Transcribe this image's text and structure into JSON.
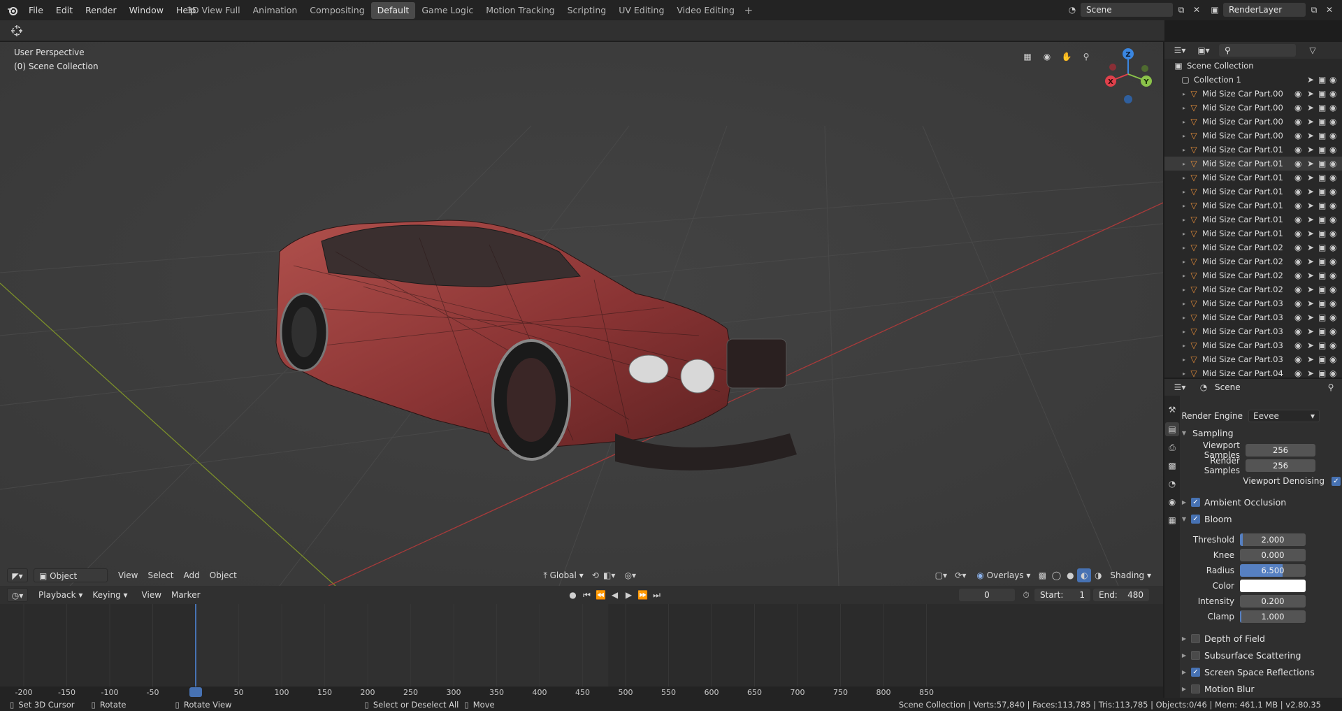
{
  "menu": [
    "File",
    "Edit",
    "Render",
    "Window",
    "Help"
  ],
  "workspaces": [
    {
      "label": "3D View Full",
      "active": false
    },
    {
      "label": "Animation",
      "active": false
    },
    {
      "label": "Compositing",
      "active": false
    },
    {
      "label": "Default",
      "active": true
    },
    {
      "label": "Game Logic",
      "active": false
    },
    {
      "label": "Motion Tracking",
      "active": false
    },
    {
      "label": "Scripting",
      "active": false
    },
    {
      "label": "UV Editing",
      "active": false
    },
    {
      "label": "Video Editing",
      "active": false
    }
  ],
  "scene_field": "Scene",
  "renderlayer_field": "RenderLayer",
  "viewport": {
    "perspective": "User Perspective",
    "collection": "(0) Scene Collection",
    "gizmo": {
      "x": "X",
      "y": "Y",
      "z": "Z"
    },
    "header": {
      "mode": "Object Mode",
      "view": "View",
      "select": "Select",
      "add": "Add",
      "object": "Object",
      "orientation": "Global",
      "overlays": "Overlays",
      "shading": "Shading"
    }
  },
  "timeline": {
    "playback": "Playback",
    "keying": "Keying",
    "view": "View",
    "marker": "Marker",
    "current_frame": "0",
    "start_label": "Start:",
    "start": "1",
    "end_label": "End:",
    "end": "480",
    "ruler": [
      "-200",
      "-150",
      "-100",
      "-50",
      "0",
      "50",
      "100",
      "150",
      "200",
      "250",
      "300",
      "350",
      "400",
      "450",
      "500",
      "550",
      "600",
      "650",
      "700",
      "750",
      "800",
      "850"
    ]
  },
  "status": {
    "left": [
      {
        "label": "Set 3D Cursor",
        "icon": "mouse-left-icon"
      },
      {
        "label": "Rotate",
        "icon": "mouse-middle-icon"
      },
      {
        "label": "Rotate View",
        "icon": "mouse-middle-icon"
      },
      {
        "label": "Select or Deselect All",
        "icon": "mouse-left-icon"
      },
      {
        "label": "Move",
        "icon": "mouse-drag-icon"
      }
    ],
    "right": "Scene Collection | Verts:57,840 | Faces:113,785 | Tris:113,785 | Objects:0/46 | Mem: 461.1 MB | v2.80.35"
  },
  "outliner": {
    "root": "Scene Collection",
    "collection": "Collection 1",
    "items": [
      "Mid Size Car Part.00",
      "Mid Size Car Part.00",
      "Mid Size Car Part.00",
      "Mid Size Car Part.00",
      "Mid Size Car Part.01",
      "Mid Size Car Part.01",
      "Mid Size Car Part.01",
      "Mid Size Car Part.01",
      "Mid Size Car Part.01",
      "Mid Size Car Part.01",
      "Mid Size Car Part.01",
      "Mid Size Car Part.02",
      "Mid Size Car Part.02",
      "Mid Size Car Part.02",
      "Mid Size Car Part.02",
      "Mid Size Car Part.03",
      "Mid Size Car Part.03",
      "Mid Size Car Part.03",
      "Mid Size Car Part.03",
      "Mid Size Car Part.03",
      "Mid Size Car Part.04"
    ],
    "selected_index": 5
  },
  "properties": {
    "context": "Scene",
    "render_engine_label": "Render Engine",
    "render_engine": "Eevee",
    "sampling": "Sampling",
    "viewport_samples_label": "Viewport Samples",
    "viewport_samples": "256",
    "render_samples_label": "Render Samples",
    "render_samples": "256",
    "viewport_denoising": "Viewport Denoising",
    "ambient_occlusion": "Ambient Occlusion",
    "bloom": "Bloom",
    "threshold_label": "Threshold",
    "threshold": "2.000",
    "threshold_fill": 0.04,
    "knee_label": "Knee",
    "knee": "0.000",
    "radius_label": "Radius",
    "radius": "6.500",
    "radius_fill": 0.65,
    "color_label": "Color",
    "color_value": "#ffffff",
    "intensity_label": "Intensity",
    "intensity": "0.200",
    "clamp_label": "Clamp",
    "clamp": "1.000",
    "clamp_fill": 0.02,
    "depth_of_field": "Depth of Field",
    "subsurface": "Subsurface Scattering",
    "ssr": "Screen Space Reflections",
    "motion_blur": "Motion Blur"
  },
  "colors": {
    "accent": "#4772b3",
    "object_icon": "#e88f3a",
    "x_axis": "#e0404b",
    "y_axis": "#8bc34a",
    "z_axis": "#3a86e0",
    "car_body": "#8a3a3a"
  }
}
